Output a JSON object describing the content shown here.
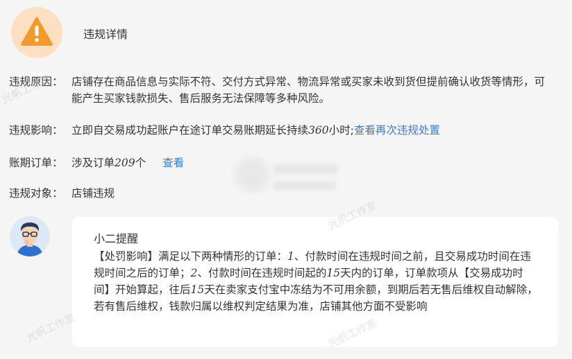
{
  "header": {
    "title": "违规详情"
  },
  "rows": {
    "reason": {
      "label": "违规原因：",
      "text": "店铺存在商品信息与实际不符、交付方式异常、物流异常或买家未收到货但提前确认收货等情形，可能产生买家钱款损失、售后服务无法保障等多种风险。"
    },
    "impact": {
      "label": "违规影响：",
      "text_pre": "立即自交易成功起账户在途订单交易账期延长持续",
      "hours": "360",
      "text_post": "小时;",
      "link": "查看再次违规处置"
    },
    "orders": {
      "label": "账期订单：",
      "text_pre": "涉及订单",
      "count": "209",
      "unit": "个",
      "link": "查看"
    },
    "target": {
      "label": "违规对象：",
      "text": "店铺违规"
    }
  },
  "reminder": {
    "title": "小二提醒",
    "p1": "【处罚影响】满足以下两种情形的订单：",
    "n1": "1",
    "p2": "、付款时间在违规时间之前，且交易成功时间在违规时间之后的订单；",
    "n2": "2",
    "p3": "、付款时间在违规时间起的",
    "n3": "15",
    "p4": "天内的订单，订单款项从【交易成功时间】开始算起，往后",
    "n4": "15",
    "p5": "天在卖家支付宝中冻结为不可用余额，到期后若无售后维权自动解除，若有售后维权，钱款归属以维权判定结果为准，店铺其他方面不受影响"
  },
  "watermark": "光帆工作室",
  "colors": {
    "link": "#3a7bd5",
    "warning": "#f39a2e",
    "warning_bg": "#fde0c2"
  },
  "icons": {
    "warning": "warning-triangle-icon",
    "assistant": "assistant-avatar"
  }
}
